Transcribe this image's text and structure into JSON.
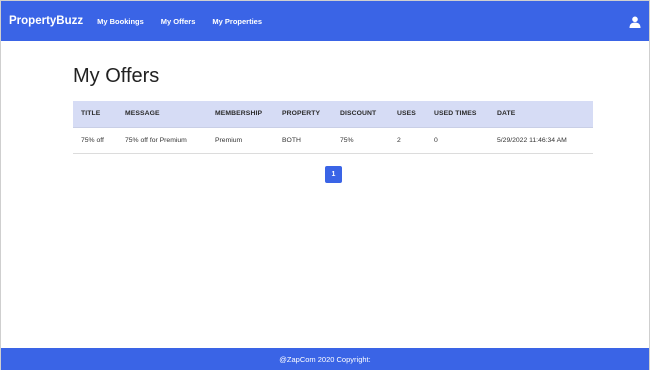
{
  "nav": {
    "brand": "PropertyBuzz",
    "links": [
      "My Bookings",
      "My Offers",
      "My Properties"
    ],
    "user_icon": "user-icon"
  },
  "page": {
    "title": "My Offers"
  },
  "table": {
    "headers": [
      "TITLE",
      "MESSAGE",
      "MEMBERSHIP",
      "PROPERTY",
      "DISCOUNT",
      "USES",
      "USED TIMES",
      "DATE"
    ],
    "rows": [
      [
        "75% off",
        "75% off for Premium",
        "Premium",
        "BOTH",
        "75%",
        "2",
        "0",
        "5/29/2022 11:46:34 AM"
      ]
    ]
  },
  "pagination": {
    "current": "1"
  },
  "footer": {
    "text": "@ZapCom 2020 Copyright:"
  },
  "colors": {
    "accent": "#3a64e6",
    "table_header_bg": "#d6dcf5"
  }
}
